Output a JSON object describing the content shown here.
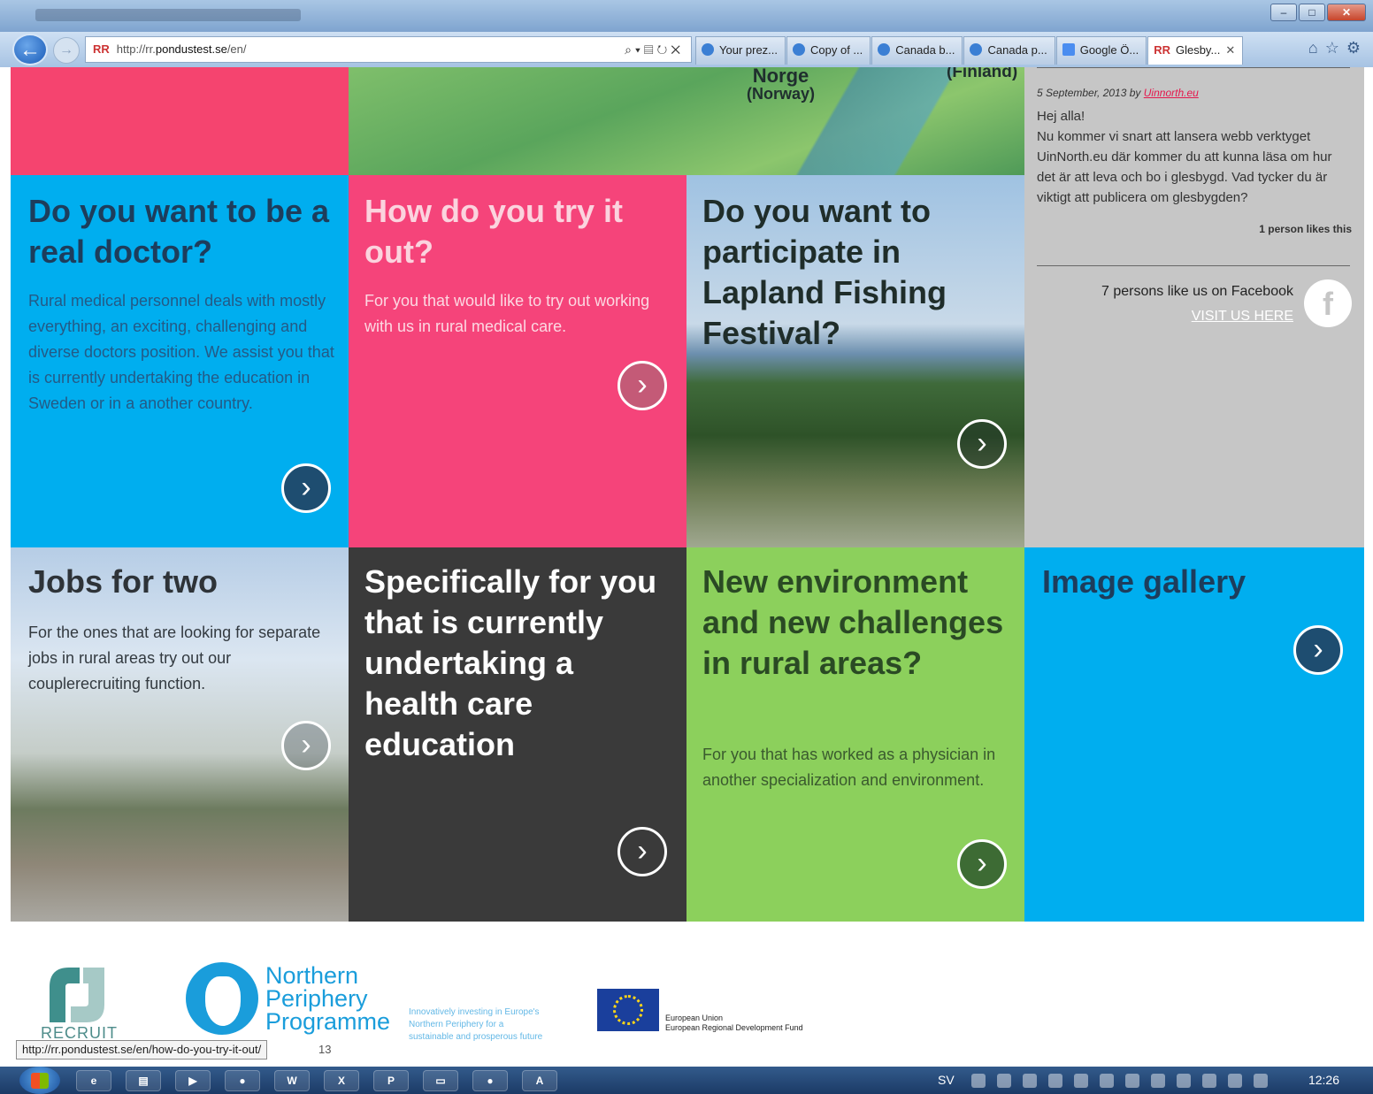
{
  "browser": {
    "address": "http://rr.pondustest.se/en/",
    "address_prefix": "http://rr.",
    "address_domain": "pondustest.se",
    "address_path": "/en/",
    "favicon_label": "RR",
    "tabs": [
      {
        "label": "Your prez..."
      },
      {
        "label": "Copy of ..."
      },
      {
        "label": "Canada b..."
      },
      {
        "label": "Canada p..."
      },
      {
        "label": "Google Ö..."
      },
      {
        "label": "Glesby..."
      }
    ]
  },
  "map": {
    "norway": "Norge",
    "norway_en": "(Norway)",
    "finland": "(Finland)"
  },
  "sidebar": {
    "post_date": "5 September, 2013 by",
    "post_author": "Uinnorth.eu",
    "post_greeting": "Hej alla!",
    "post_text": "Nu kommer vi snart att lansera webb verktyget UinNorth.eu där kommer du att kunna läsa om hur det är att leva och bo i glesbygd. Vad tycker du är viktigt att publicera om glesbygden?",
    "post_likes": "1 person likes this",
    "facebook_text": "7 persons like us on Facebook",
    "facebook_link": "VISIT US HERE"
  },
  "tiles": {
    "doctor": {
      "title": "Do you want to be a real doctor?",
      "text": "Rural medical personnel deals with mostly everything, an exciting, challenging and diverse doctors position. We assist you that is currently undertaking the education in Sweden or in a another country."
    },
    "try": {
      "title": "How do you try it out?",
      "text": "For you that would like to try out working with us in rural medical care."
    },
    "fishing": {
      "title": "Do you want to participate in Lapland Fishing Festival?"
    },
    "jobs": {
      "title": "Jobs for two",
      "text": "For the ones that are looking for separate jobs in rural areas try out our couplerecruiting function."
    },
    "specific": {
      "title": "Specifically for you that is currently undertaking a health care education"
    },
    "environment": {
      "title": "New environment and new challenges in rural areas?",
      "text": "For you that has worked as a physician in another specialization and environment."
    },
    "gallery": {
      "title": "Image gallery"
    }
  },
  "footer": {
    "recruit_logo": "RECRUIT",
    "npp_line1": "Northern",
    "npp_line2": "Periphery",
    "npp_line3": "Programme",
    "npp_tagline": "Innovatively investing in Europe's Northern Periphery for a sustainable and prosperous future",
    "eu_line1": "European Union",
    "eu_line2": "European Regional Development Fund",
    "year_fragment": "13"
  },
  "status_bar": {
    "hover_url": "http://rr.pondustest.se/en/how-do-you-try-it-out/"
  },
  "taskbar": {
    "language": "SV",
    "time": "12:26"
  },
  "colors": {
    "blue": "#00aeef",
    "pink": "#f5447a",
    "dark": "#3a3a3a",
    "green": "#8cd05c",
    "gray": "#c6c6c6"
  }
}
